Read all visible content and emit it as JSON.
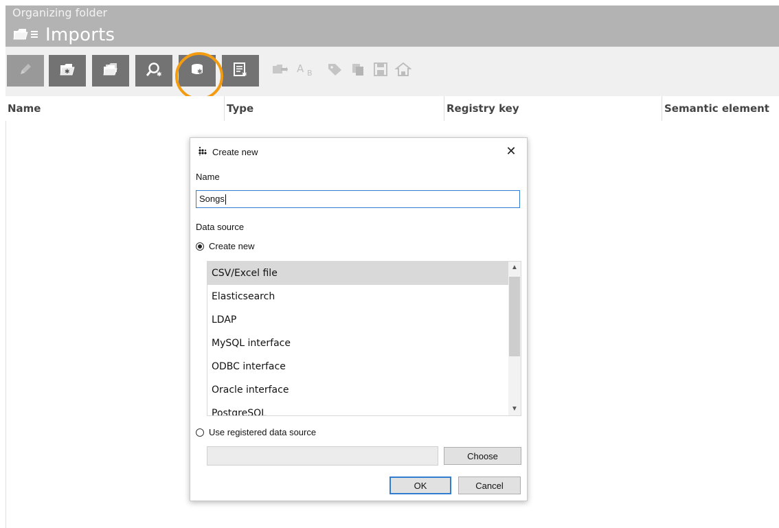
{
  "header": {
    "subtitle": "Organizing folder",
    "title": "Imports"
  },
  "toolbar": {
    "buttons": [
      {
        "icon": "pencil-icon",
        "enabled": false
      },
      {
        "icon": "folder-add-icon",
        "enabled": true
      },
      {
        "icon": "folders-icon",
        "enabled": true
      },
      {
        "icon": "search-add-icon",
        "enabled": true
      },
      {
        "icon": "database-add-icon",
        "enabled": true,
        "highlighted": true
      },
      {
        "icon": "form-add-icon",
        "enabled": true
      }
    ],
    "disabled_icons": [
      "move-icon",
      "rename-icon",
      "tag-icon",
      "copy-icon",
      "save-icon",
      "home-icon"
    ],
    "highlight_color": "#f39c12"
  },
  "columns": [
    "Name",
    "Type",
    "Registry key",
    "Semantic element"
  ],
  "dialog": {
    "title": "Create new",
    "name_label": "Name",
    "name_value": "Songs",
    "data_source_label": "Data source",
    "create_new_label": "Create new",
    "list_items": [
      "CSV/Excel file",
      "Elasticsearch",
      "LDAP",
      "MySQL interface",
      "ODBC interface",
      "Oracle interface",
      "PostgreSQL"
    ],
    "selected_item": "CSV/Excel file",
    "use_registered_label": "Use registered data source",
    "registered_source_value": "",
    "choose_label": "Choose",
    "ok_label": "OK",
    "cancel_label": "Cancel"
  }
}
